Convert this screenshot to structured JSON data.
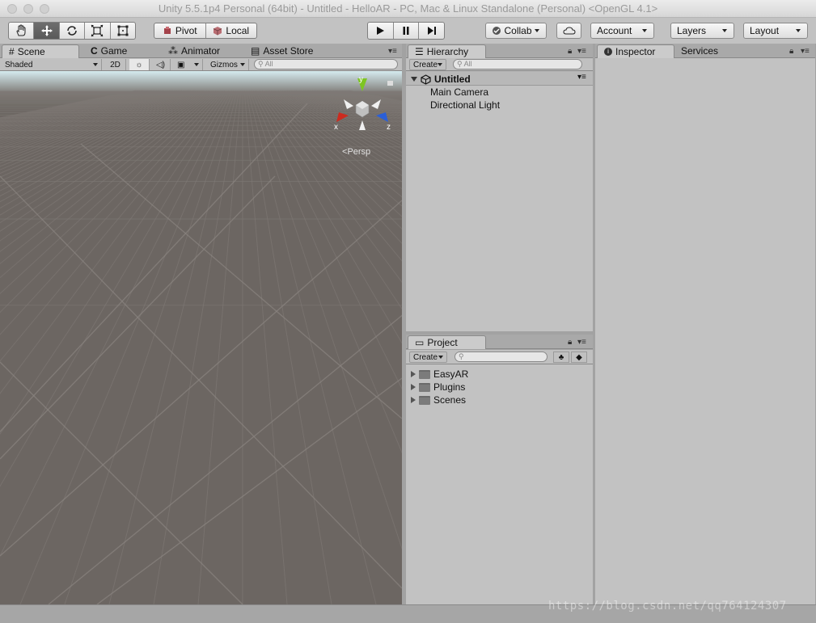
{
  "window": {
    "title": "Unity 5.5.1p4 Personal (64bit) - Untitled - HelloAR - PC, Mac & Linux Standalone (Personal) <OpenGL 4.1>"
  },
  "toolbar": {
    "tools": [
      "hand-tool-icon",
      "move-tool-icon",
      "rotate-tool-icon",
      "scale-tool-icon",
      "rect-tool-icon"
    ],
    "pivot_label": "Pivot",
    "local_label": "Local",
    "collab_label": "Collab",
    "account_label": "Account",
    "layers_label": "Layers",
    "layout_label": "Layout"
  },
  "scene_panel": {
    "tabs": {
      "scene": "Scene",
      "game": "Game",
      "animator": "Animator",
      "asset_store": "Asset Store"
    },
    "shading_mode": "Shaded",
    "mode_2d": "2D",
    "gizmos_label": "Gizmos",
    "search_placeholder": "All",
    "gizmo_axes": {
      "x": "x",
      "y": "y",
      "z": "z"
    },
    "projection_label": "Persp"
  },
  "hierarchy_panel": {
    "tab": "Hierarchy",
    "create_label": "Create",
    "search_placeholder": "All",
    "scene_name": "Untitled",
    "items": [
      "Main Camera",
      "Directional Light"
    ]
  },
  "project_panel": {
    "tab": "Project",
    "create_label": "Create",
    "folders": [
      "EasyAR",
      "Plugins",
      "Scenes"
    ]
  },
  "inspector_panel": {
    "tabs": {
      "inspector": "Inspector",
      "services": "Services"
    }
  },
  "watermark": "https://blog.csdn.net/qq764124307",
  "colors": {
    "viewport_ground": "#6c6662",
    "panel_bg": "#c2c2c2",
    "axis_x": "#cc2b1f",
    "axis_y": "#7ec523",
    "axis_z": "#2a5fd8"
  }
}
